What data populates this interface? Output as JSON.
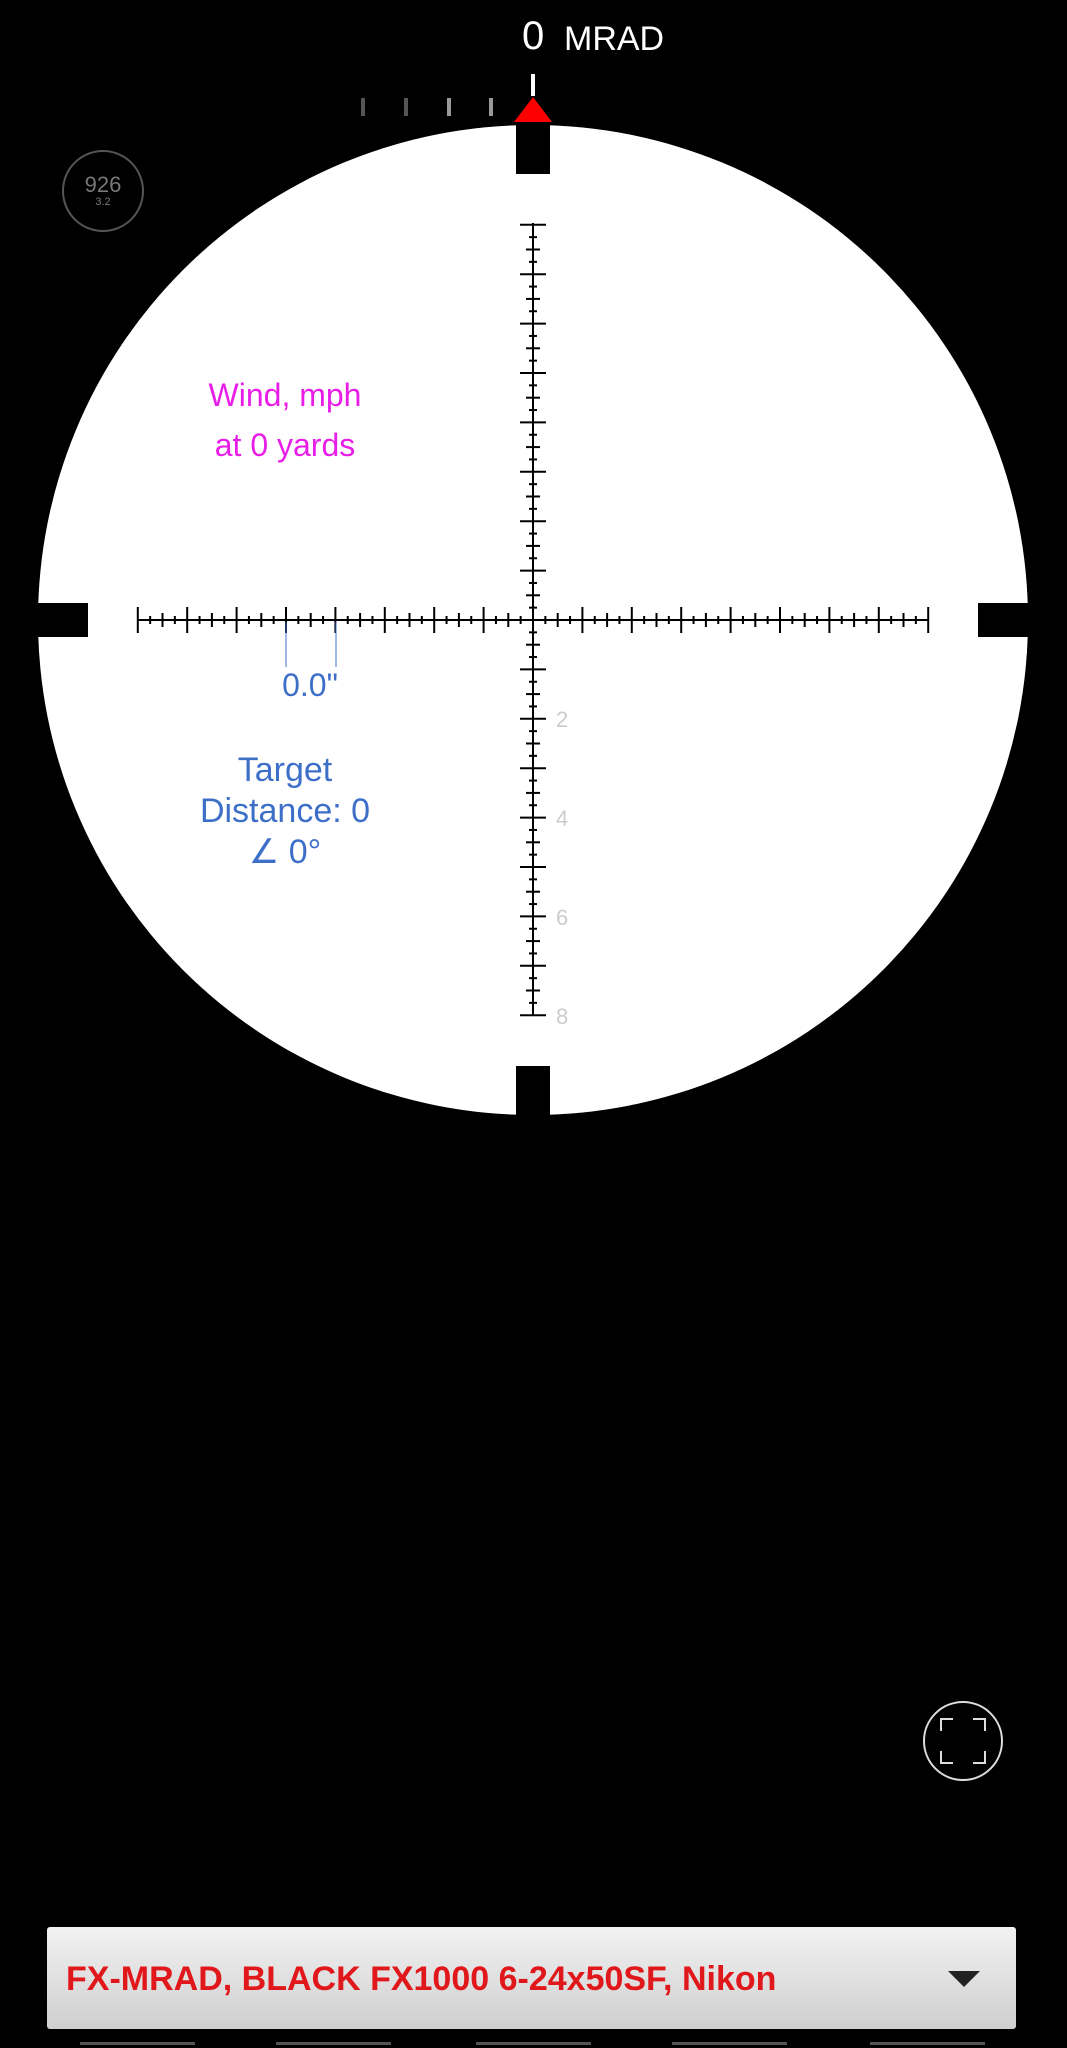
{
  "elevation": {
    "value": "0",
    "unit": "MRAD"
  },
  "zoom_badge": {
    "main": "926",
    "sub": "3.2"
  },
  "wind": {
    "line1": "Wind, mph",
    "line2": "at 0 yards"
  },
  "spread": {
    "label": "0.0\""
  },
  "target": {
    "line1": "Target",
    "line2": "Distance: 0",
    "line3": "∠ 0°"
  },
  "reticle": {
    "mil_labels": [
      "2",
      "4",
      "6",
      "8"
    ]
  },
  "scope_selector": {
    "label": "FX-MRAD, BLACK FX1000 6-24x50SF, Nikon"
  },
  "colors": {
    "wind": "#e81ee8",
    "target": "#3d6fc9",
    "selector_text": "#e0181b",
    "pointer": "#ff0000"
  },
  "icons": {
    "fullscreen": "fullscreen-icon",
    "dropdown": "chevron-down-icon",
    "pointer": "triangle-pointer-icon"
  }
}
